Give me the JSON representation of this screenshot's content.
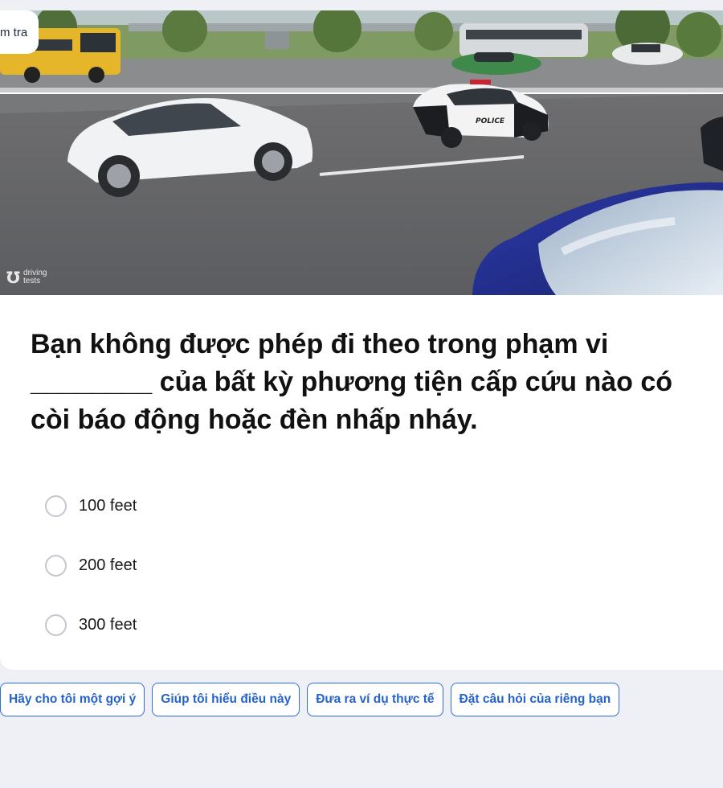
{
  "tag": {
    "label": "m tra"
  },
  "watermark": {
    "line1": "driving",
    "line2": "tests"
  },
  "scene": {
    "police_text": "POLICE"
  },
  "question": {
    "text": "Bạn không được phép đi theo trong phạm vi ________ của bất kỳ phương tiện cấp cứu nào có còi báo động hoặc đèn nhấp nháy."
  },
  "options": [
    {
      "label": "100 feet"
    },
    {
      "label": "200 feet"
    },
    {
      "label": "300 feet"
    }
  ],
  "chips": [
    {
      "label": "Hãy cho tôi một gợi ý"
    },
    {
      "label": "Giúp tôi hiểu điều này"
    },
    {
      "label": "Đưa ra ví dụ thực tế"
    },
    {
      "label": "Đặt câu hỏi của riêng bạn"
    }
  ],
  "colors": {
    "accent": "#2b6fdb",
    "background": "#eef0f5",
    "card": "#ffffff"
  }
}
